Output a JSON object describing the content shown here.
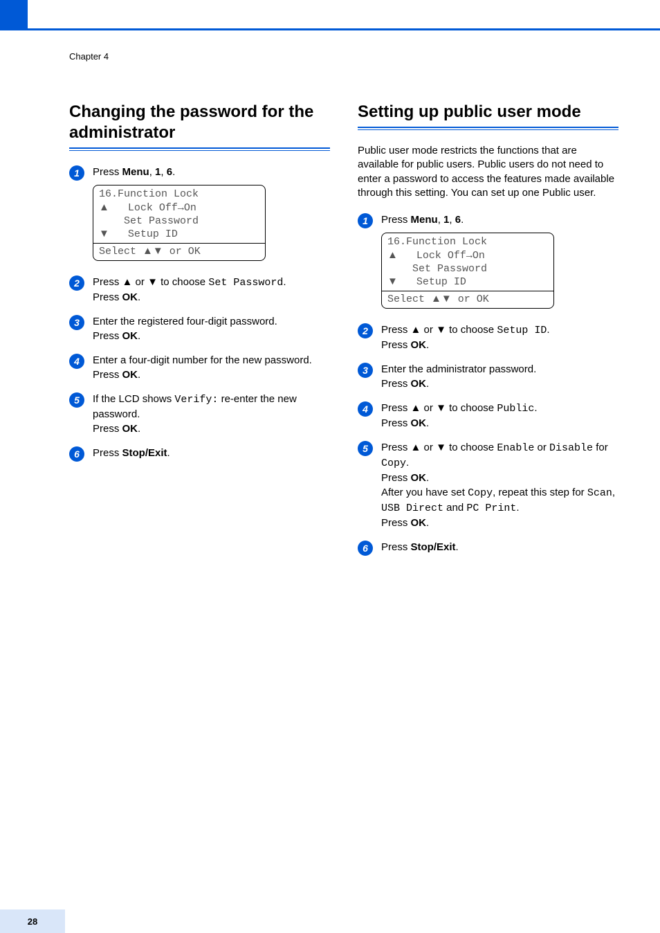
{
  "chapter": "Chapter 4",
  "page_number": "28",
  "left": {
    "title": "Changing the password for the administrator",
    "steps": {
      "s1_pre": "Press ",
      "s1_menu": "Menu",
      "s1_sep1": ", ",
      "s1_n1": "1",
      "s1_sep2": ", ",
      "s1_n2": "6",
      "s1_post": ".",
      "lcd": {
        "l1": "16.Function Lock",
        "l2a": "a",
        "l2": "   Lock Off→On",
        "l3": "    Set Password",
        "l4a": "b",
        "l4": "   Setup ID",
        "footer_pre": "Select ",
        "footer_sym": "ab",
        "footer_post": " or OK"
      },
      "s2_pre": "Press ",
      "s2_up": "a",
      "s2_mid1": " or ",
      "s2_dn": "b",
      "s2_mid2": " to choose ",
      "s2_mono": "Set Password",
      "s2_post1": ".",
      "s2_line2a": "Press ",
      "s2_ok": "OK",
      "s2_line2b": ".",
      "s3_a": "Enter the registered four-digit password.",
      "s3_b_pre": "Press ",
      "s3_b_ok": "OK",
      "s3_b_post": ".",
      "s4_a": "Enter a four-digit number for the new password.",
      "s4_b_pre": "Press ",
      "s4_b_ok": "OK",
      "s4_b_post": ".",
      "s5_pre": "If the LCD shows ",
      "s5_mono": "Verify:",
      "s5_mid": " re-enter the new password.",
      "s5_b_pre": "Press ",
      "s5_b_ok": "OK",
      "s5_b_post": ".",
      "s6_pre": "Press ",
      "s6_stop": "Stop/Exit",
      "s6_post": "."
    }
  },
  "right": {
    "title": "Setting up public user mode",
    "intro": "Public user mode restricts the functions that are available for public users. Public users do not need to enter a password to access the features made available through this setting. You can set up one Public user.",
    "steps": {
      "s1_pre": "Press ",
      "s1_menu": "Menu",
      "s1_sep1": ", ",
      "s1_n1": "1",
      "s1_sep2": ", ",
      "s1_n2": "6",
      "s1_post": ".",
      "lcd": {
        "l1": "16.Function Lock",
        "l2a": "a",
        "l2": "   Lock Off→On",
        "l3": "    Set Password",
        "l4a": "b",
        "l4": "   Setup ID",
        "footer_pre": "Select ",
        "footer_sym": "ab",
        "footer_post": " or OK"
      },
      "s2_pre": "Press ",
      "s2_up": "a",
      "s2_mid1": " or ",
      "s2_dn": "b",
      "s2_mid2": " to choose ",
      "s2_mono": "Setup ID",
      "s2_post1": ".",
      "s2_line2a": "Press ",
      "s2_ok": "OK",
      "s2_line2b": ".",
      "s3_a": "Enter the administrator password.",
      "s3_b_pre": "Press ",
      "s3_b_ok": "OK",
      "s3_b_post": ".",
      "s4_pre": "Press ",
      "s4_up": "a",
      "s4_mid1": " or ",
      "s4_dn": "b",
      "s4_mid2": " to choose ",
      "s4_mono": "Public",
      "s4_post1": ".",
      "s4_line2a": "Press ",
      "s4_ok": "OK",
      "s4_line2b": ".",
      "s5_pre": "Press ",
      "s5_up": "a",
      "s5_mid1": " or ",
      "s5_dn": "b",
      "s5_mid2": " to choose ",
      "s5_mono1": "Enable",
      "s5_or": " or ",
      "s5_mono2": "Disable",
      "s5_for": " for ",
      "s5_mono3": "Copy",
      "s5_dot": ".",
      "s5_l2a": "Press ",
      "s5_l2ok": "OK",
      "s5_l2b": ".",
      "s5_l3a": "After you have set ",
      "s5_l3mono1": "Copy",
      "s5_l3b": ", repeat this step for ",
      "s5_l3mono2": "Scan",
      "s5_l3c": ", ",
      "s5_l3mono3": "USB Direct",
      "s5_l3d": " and ",
      "s5_l3mono4": "PC Print",
      "s5_l3e": ".",
      "s5_l4a": "Press ",
      "s5_l4ok": "OK",
      "s5_l4b": ".",
      "s6_pre": "Press ",
      "s6_stop": "Stop/Exit",
      "s6_post": "."
    }
  }
}
